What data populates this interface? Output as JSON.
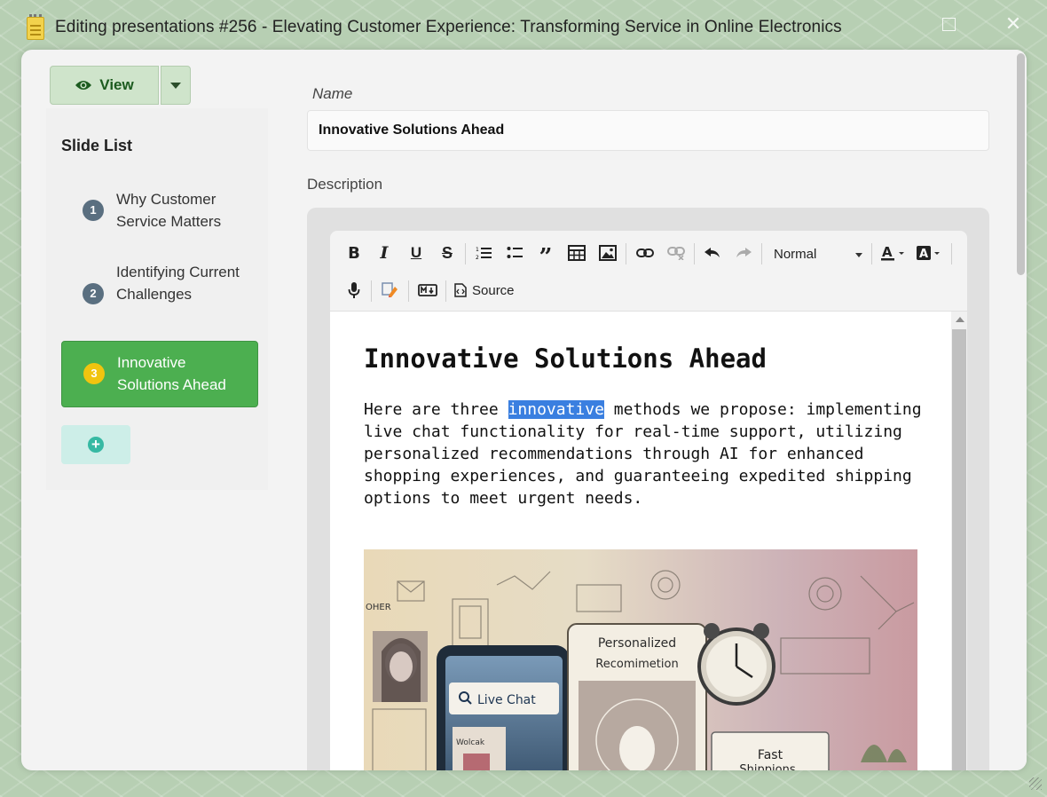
{
  "window": {
    "title": "Editing presentations #256 - Elevating Customer Experience: Transforming Service in Online Electronics"
  },
  "view_button": {
    "label": "View"
  },
  "slide_list": {
    "title": "Slide List",
    "items": [
      {
        "number": "1",
        "label": "Why Customer Service Matters"
      },
      {
        "number": "2",
        "label": "Identifying Current Challenges"
      },
      {
        "number": "3",
        "label": "Innovative Solutions Ahead",
        "active": true
      }
    ]
  },
  "form": {
    "name_label": "Name",
    "name_value": "Innovative Solutions Ahead",
    "description_label": "Description"
  },
  "toolbar": {
    "format_value": "Normal",
    "source_label": "Source"
  },
  "content": {
    "heading": "Innovative Solutions Ahead",
    "para_before": "Here are three ",
    "para_highlight": "innovative",
    "para_after": " methods we propose: implementing live chat functionality for real-time support, utilizing personalized recommendations through AI for enhanced shopping experiences, and guaranteeing expedited shipping options to meet urgent needs."
  },
  "image": {
    "label_personalized": "Personalized",
    "label_recommendation": "Recomimetion",
    "label_live_chat": "Live Chat",
    "label_fast": "Fast",
    "label_shipping": "Shippions",
    "label_other": "OHER",
    "label_web": "Wolcak"
  }
}
